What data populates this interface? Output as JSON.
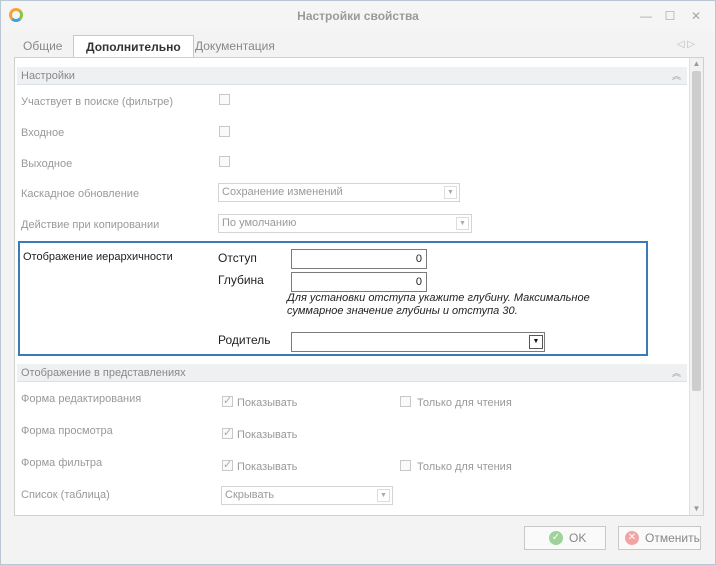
{
  "window": {
    "title": "Настройки свойства"
  },
  "tabs": [
    {
      "label": "Общие"
    },
    {
      "label": "Дополнительно"
    },
    {
      "label": "Документация"
    }
  ],
  "settings_section": {
    "header": "Настройки",
    "search_label": "Участвует в поиске (фильтре)",
    "input_label": "Входное",
    "output_label": "Выходное",
    "cascade_label": "Каскадное обновление",
    "cascade_value": "Сохранение изменений",
    "copy_label": "Действие при копировании",
    "copy_value": "По умолчанию"
  },
  "hierarchy": {
    "label": "Отображение иерархичности",
    "indent_label": "Отступ",
    "indent_value": "0",
    "depth_label": "Глубина",
    "depth_value": "0",
    "hint": "Для установки отступа укажите глубину. Максимальное суммарное значение глубины и отступа 30.",
    "parent_label": "Родитель",
    "parent_value": ""
  },
  "views_section": {
    "header": "Отображение в представлениях",
    "edit_form_label": "Форма редактирования",
    "view_form_label": "Форма просмотра",
    "filter_form_label": "Форма фильтра",
    "list_label": "Список (таблица)",
    "show_label": "Показывать",
    "readonly_label": "Только для чтения",
    "list_value": "Скрывать"
  },
  "footer": {
    "ok_label": "OK",
    "cancel_label": "Отменить"
  }
}
